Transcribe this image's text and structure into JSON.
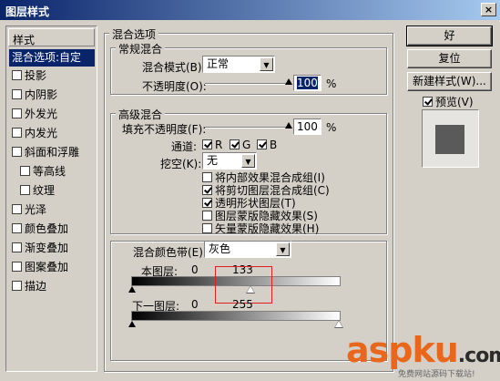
{
  "window": {
    "title": "图层样式",
    "close_glyph": "×"
  },
  "left_panel": {
    "header": "样式",
    "items": [
      {
        "label": "混合选项:自定",
        "checkbox": false,
        "selected": true
      },
      {
        "label": "投影",
        "checkbox": true,
        "checked": false
      },
      {
        "label": "内阴影",
        "checkbox": true,
        "checked": false
      },
      {
        "label": "外发光",
        "checkbox": true,
        "checked": false
      },
      {
        "label": "内发光",
        "checkbox": true,
        "checked": false
      },
      {
        "label": "斜面和浮雕",
        "checkbox": true,
        "checked": false
      },
      {
        "label": "等高线",
        "checkbox": true,
        "checked": false,
        "sub": true
      },
      {
        "label": "纹理",
        "checkbox": true,
        "checked": false,
        "sub": true
      },
      {
        "label": "光泽",
        "checkbox": true,
        "checked": false
      },
      {
        "label": "颜色叠加",
        "checkbox": true,
        "checked": false
      },
      {
        "label": "渐变叠加",
        "checkbox": true,
        "checked": false
      },
      {
        "label": "图案叠加",
        "checkbox": true,
        "checked": false
      },
      {
        "label": "描边",
        "checkbox": true,
        "checked": false
      }
    ]
  },
  "blend_options": {
    "group_title": "混合选项",
    "general": {
      "title": "常规混合",
      "mode_label": "混合模式(B):",
      "mode_value": "正常",
      "opacity_label": "不透明度(O):",
      "opacity_value": "100",
      "percent": "%"
    },
    "advanced": {
      "title": "高级混合",
      "fill_label": "填充不透明度(F):",
      "fill_value": "100",
      "percent": "%",
      "channels_label": "通道:",
      "channels": [
        {
          "label": "R",
          "checked": true
        },
        {
          "label": "G",
          "checked": true
        },
        {
          "label": "B",
          "checked": true
        }
      ],
      "knockout_label": "挖空(K):",
      "knockout_value": "无",
      "options": [
        {
          "label": "将内部效果混合成组(I)",
          "checked": false
        },
        {
          "label": "将剪切图层混合成组(C)",
          "checked": true
        },
        {
          "label": "透明形状图层(T)",
          "checked": true
        },
        {
          "label": "图层蒙版隐藏效果(S)",
          "checked": false
        },
        {
          "label": "矢量蒙版隐藏效果(H)",
          "checked": false
        }
      ]
    },
    "blend_if": {
      "label": "混合颜色带(E):",
      "value": "灰色",
      "this_layer": {
        "label": "本图层:",
        "low": "0",
        "high": "133",
        "high_fraction": 0.52
      },
      "underlying": {
        "label": "下一图层:",
        "low": "0",
        "high": "255"
      }
    }
  },
  "buttons": {
    "ok": "好",
    "reset": "复位",
    "new_style": "新建样式(W)...",
    "preview_label": "预览(V)",
    "preview_checked": true
  },
  "watermark": {
    "text_a": "asp",
    "text_b": "ku",
    "text_c": ".com",
    "sub": "免费网站源码下载站!"
  },
  "colors": {
    "dialog_bg": "#d4d0c8",
    "selection": "#0a246a",
    "highlight": "#e02020",
    "preview_swatch": "#5a5a5a",
    "watermark_orange": "#e8671c"
  }
}
